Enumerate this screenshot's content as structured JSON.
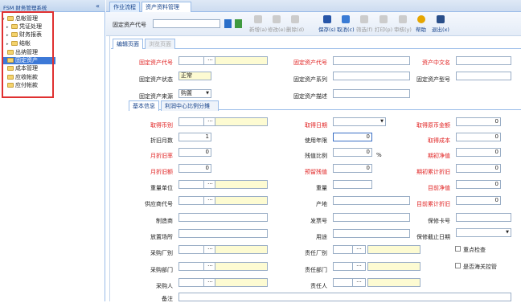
{
  "sidebar": {
    "title": "FSM 财务管理系统",
    "collapse": "«",
    "items": [
      {
        "label": "总帐管理",
        "level": 0
      },
      {
        "label": "凭证处理",
        "level": 1
      },
      {
        "label": "财务报表",
        "level": 1
      },
      {
        "label": "结帐",
        "level": 1
      },
      {
        "label": "出纳管理",
        "level": 0
      },
      {
        "label": "固定资产",
        "level": 0
      },
      {
        "label": "成本管理",
        "level": 0
      },
      {
        "label": "应收帐款",
        "level": 0
      },
      {
        "label": "应付帐款",
        "level": 0
      }
    ]
  },
  "tabs": {
    "t1": "作业流程",
    "t2": "资产资料管理",
    "close": "×"
  },
  "toolbar": {
    "asset_code_label": "固定资产代号",
    "new": "新增(a)",
    "edit": "修改(e)",
    "delete": "删除(d)",
    "save": "保存(s)",
    "cancel": "取消(c)",
    "filter": "筛选(f)",
    "print": "打印(p)",
    "audit": "审核(y)",
    "help": "帮助",
    "exit": "退出(x)"
  },
  "edit_tabs": {
    "edit": "编辑页面",
    "browse": "浏览页面"
  },
  "form": {
    "asset_code": "固定资产代号",
    "asset_code2": "固定资产代号",
    "asset_cn": "资产中文名",
    "status": "固定资产状态",
    "status_val": "正常",
    "series": "固定资产系列",
    "model": "固定资产型号",
    "source": "固定资产来源",
    "source_val": "购置",
    "desc": "固定资产描述"
  },
  "sub_tabs": {
    "basic": "基本信息",
    "profit": "利润中心比例分摊"
  },
  "basic": {
    "currency": "取得币别",
    "acq_date": "取得日期",
    "orig_amt": "取得原币金额",
    "orig_amt_val": "0",
    "dep_months": "折旧月数",
    "dep_months_val": "1",
    "use_years": "使用年限",
    "use_years_val": "0",
    "cost": "取得成本",
    "cost_val": "0",
    "monthly_rate": "月折旧率",
    "monthly_rate_val": "0",
    "salvage_ratio": "残值比例",
    "salvage_ratio_val": "0",
    "pct": "%",
    "init_net": "期初净值",
    "init_net_val": "0",
    "monthly_amt": "月折旧额",
    "monthly_amt_val": "0",
    "salvage": "预留残值",
    "salvage_val": "0",
    "init_acc": "期初累计折旧",
    "init_acc_val": "0",
    "weight_unit": "重量单位",
    "weight": "重量",
    "cur_net": "目前净值",
    "cur_net_val": "0",
    "supplier": "供应商代号",
    "origin": "产地",
    "cur_acc": "目前累计折旧",
    "cur_acc_val": "0",
    "maker": "制造商",
    "invoice": "发票号",
    "warranty": "保修卡号",
    "location": "放置场所",
    "usage": "用途",
    "warranty_end": "保修截止日期",
    "buy_factory": "采购厂别",
    "resp_factory": "责任厂别",
    "key_check": "重点检查",
    "buy_dept": "采购部门",
    "resp_dept": "责任部门",
    "customs": "是否海关控管",
    "buyer": "采购人",
    "resp_person": "责任人",
    "remark": "备注"
  }
}
